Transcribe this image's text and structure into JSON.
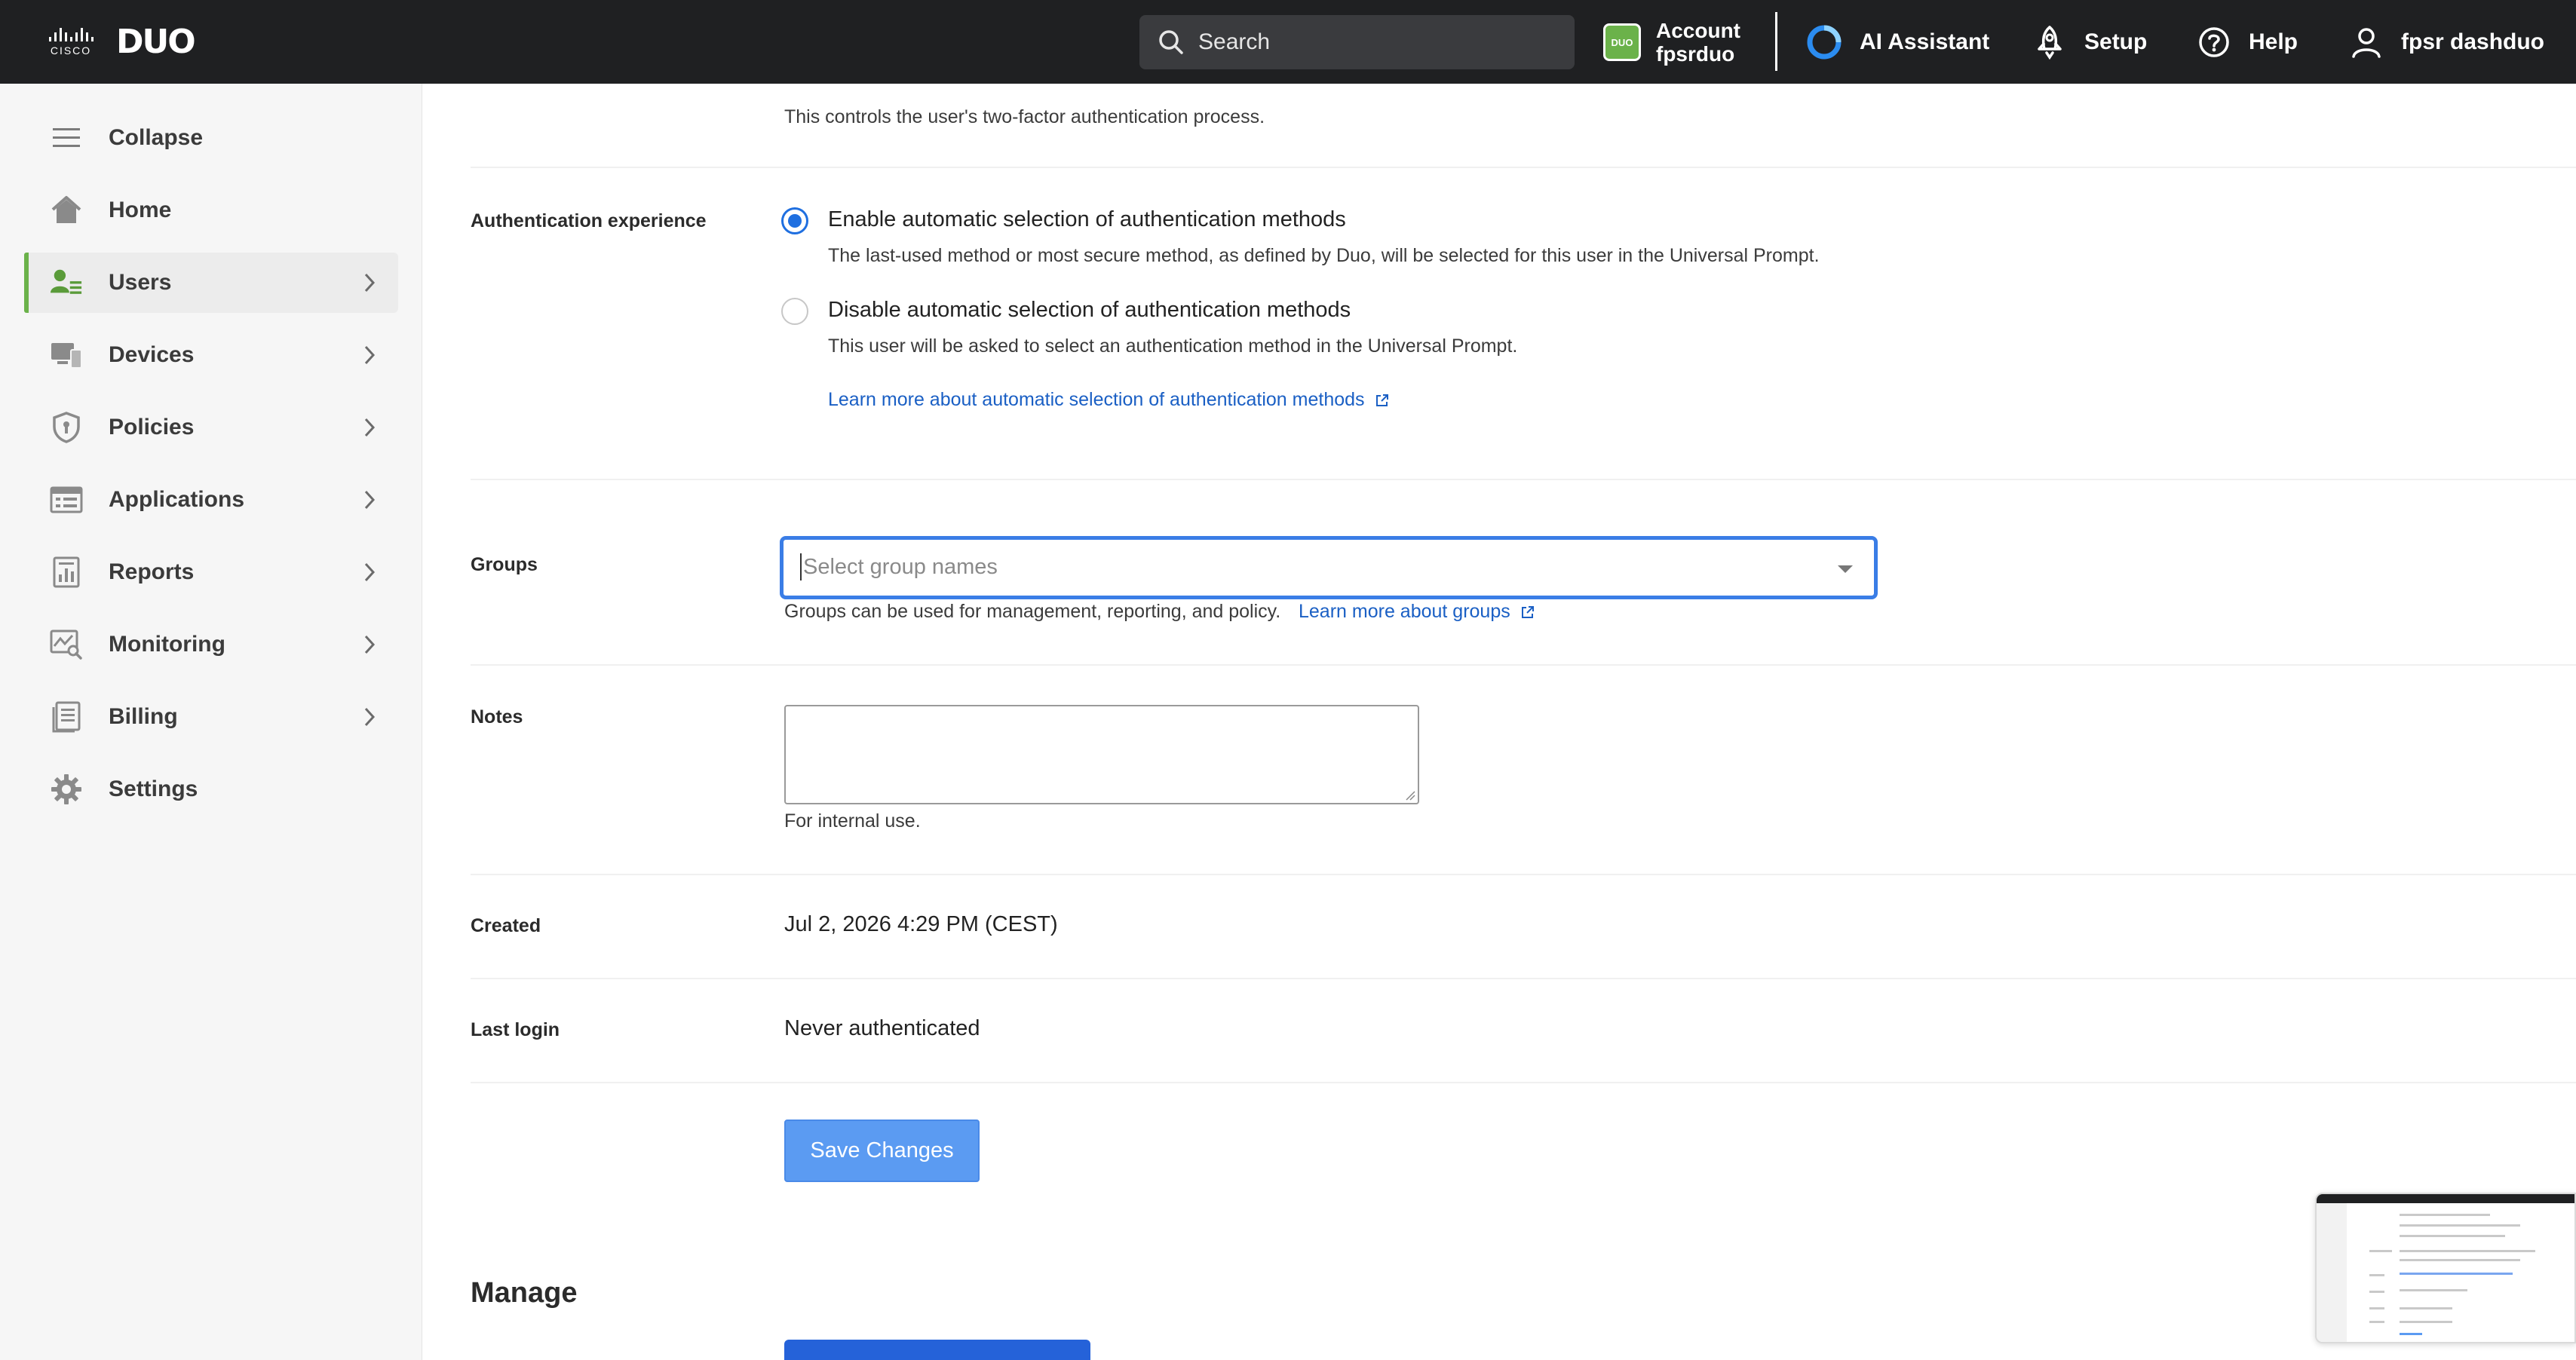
{
  "topbar": {
    "cisco_word": "CISCO",
    "duo_word": "DUO",
    "search_placeholder": "Search",
    "account_badge": "DUO",
    "account_label": "Account",
    "account_name": "fpsrduo",
    "ai_assistant": "AI Assistant",
    "setup": "Setup",
    "help": "Help",
    "user": "fpsr dashduo"
  },
  "sidebar": {
    "items": [
      {
        "label": "Collapse",
        "icon": "menu-icon"
      },
      {
        "label": "Home",
        "icon": "home-icon"
      },
      {
        "label": "Users",
        "icon": "users-icon",
        "active": true
      },
      {
        "label": "Devices",
        "icon": "devices-icon"
      },
      {
        "label": "Policies",
        "icon": "shield-icon"
      },
      {
        "label": "Applications",
        "icon": "applications-icon"
      },
      {
        "label": "Reports",
        "icon": "reports-icon"
      },
      {
        "label": "Monitoring",
        "icon": "monitoring-icon"
      },
      {
        "label": "Billing",
        "icon": "billing-icon"
      },
      {
        "label": "Settings",
        "icon": "gear-icon"
      }
    ]
  },
  "main": {
    "top_help": "This controls the user's two-factor authentication process.",
    "auth_experience": {
      "label": "Authentication experience",
      "option1_title": "Enable automatic selection of authentication methods",
      "option1_desc": "The last-used method or most secure method, as defined by Duo, will be selected for this user in the Universal Prompt.",
      "option2_title": "Disable automatic selection of authentication methods",
      "option2_desc": "This user will be asked to select an authentication method in the Universal Prompt.",
      "learn_more": "Learn more about automatic selection of authentication methods",
      "selected": "option1"
    },
    "groups": {
      "label": "Groups",
      "placeholder": "Select group names",
      "help": "Groups can be used for management, reporting, and policy.",
      "learn_more": "Learn more about groups"
    },
    "notes": {
      "label": "Notes",
      "value": "",
      "help": "For internal use."
    },
    "created": {
      "label": "Created",
      "value": "Jul 2, 2026 4:29 PM (CEST)"
    },
    "last_login": {
      "label": "Last login",
      "value": "Never authenticated"
    },
    "save_button": "Save Changes",
    "manage_heading": "Manage"
  },
  "colors": {
    "topbar_bg": "#1f2022",
    "accent_green": "#6bb24a",
    "link_blue": "#1a5fc4",
    "primary_blue": "#2562d9",
    "save_button_bg": "#5b9bf2"
  }
}
